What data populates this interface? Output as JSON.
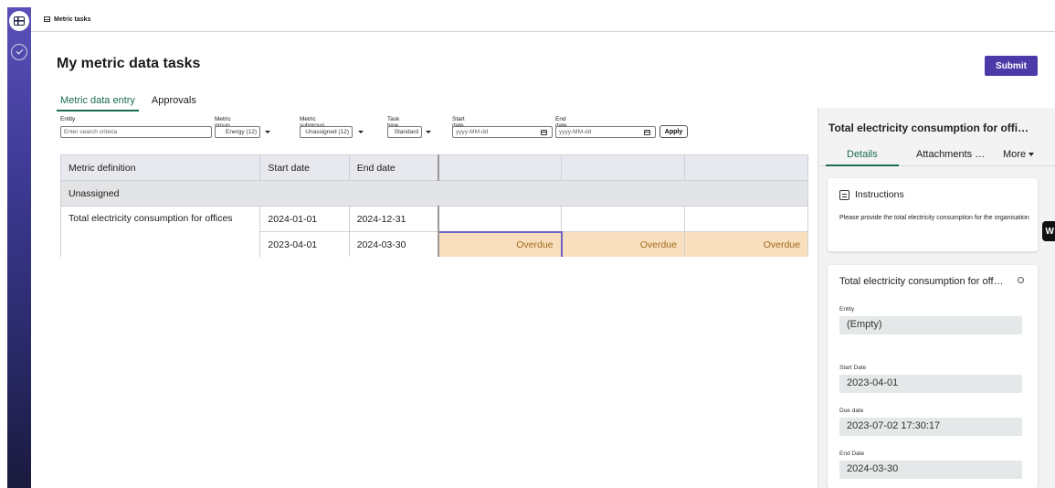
{
  "app": {
    "breadcrumb": "Metric tasks"
  },
  "page": {
    "title": "My metric data tasks",
    "submit_label": "Submit"
  },
  "tabs": [
    {
      "label": "Metric data entry",
      "active": true
    },
    {
      "label": "Approvals",
      "active": false
    }
  ],
  "filters": {
    "entity": {
      "label": "Entity",
      "placeholder": "Enter search criteria"
    },
    "metric_group": {
      "label": "Metric group",
      "value": "Energy (12)"
    },
    "metric_subgroup": {
      "label": "Metric subgroup",
      "value": "Unassigned (12)"
    },
    "task_type": {
      "label": "Task type",
      "value": "Standard"
    },
    "start_date": {
      "label": "Start date",
      "placeholder": "yyyy-MM-dd"
    },
    "end_date": {
      "label": "End date",
      "placeholder": "yyyy-MM-dd"
    },
    "apply_label": "Apply"
  },
  "table": {
    "headers": [
      "Metric definition",
      "Start date",
      "End date",
      "",
      "",
      ""
    ],
    "group": "Unassigned",
    "metric": "Total electricity consumption for offices",
    "rows": [
      {
        "start": "2024-01-01",
        "end": "2024-12-31",
        "cells": [
          "",
          "",
          ""
        ]
      },
      {
        "start": "2023-04-01",
        "end": "2024-03-30",
        "cells": [
          "Overdue",
          "Overdue",
          "Overdue"
        ]
      }
    ]
  },
  "panel": {
    "title": "Total electricity consumption for offi…",
    "tabs": [
      "Details",
      "Attachments …",
      "More"
    ],
    "instructions_title": "Instructions",
    "instructions_text": "Please provide the total electricity consumption for the organisation",
    "card_title": "Total electricity consumption for off…",
    "fields": [
      {
        "label": "Entity",
        "value": "(Empty)"
      },
      {
        "label": "Start Date",
        "value": "2023-04-01"
      },
      {
        "label": "Due date",
        "value": "2023-07-02 17:30:17"
      },
      {
        "label": "End Date",
        "value": "2024-03-30"
      }
    ]
  },
  "badge": "W",
  "colors": {
    "accent": "#4d3aa8",
    "tab_active": "#1b6b4f",
    "overdue_bg": "#f9dfbe",
    "overdue_text": "#a06a1c"
  }
}
